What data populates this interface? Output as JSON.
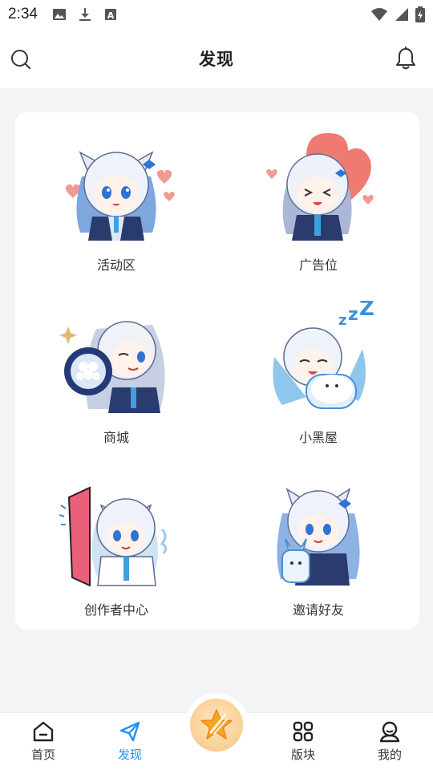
{
  "status_bar": {
    "time": "2:34",
    "left_icons": [
      "image-icon",
      "download-icon",
      "text-a-icon"
    ],
    "right_icons": [
      "wifi-icon",
      "signal-icon",
      "battery-icon"
    ]
  },
  "header": {
    "title": "发现",
    "left_icon": "search-icon",
    "right_icon": "bell-icon"
  },
  "grid": {
    "items": [
      {
        "label": "活动区",
        "icon": "mascot-hearts-illustration"
      },
      {
        "label": "广告位",
        "icon": "mascot-balloon-illustration"
      },
      {
        "label": "商城",
        "icon": "mascot-bouquet-illustration"
      },
      {
        "label": "小黑屋",
        "icon": "mascot-sleeping-illustration"
      },
      {
        "label": "创作者中心",
        "icon": "mascot-door-illustration"
      },
      {
        "label": "邀请好友",
        "icon": "mascot-plush-illustration"
      }
    ]
  },
  "bottom_nav": {
    "items": [
      {
        "label": "首页",
        "icon": "home-icon",
        "active": false
      },
      {
        "label": "发现",
        "icon": "paper-plane-icon",
        "active": true
      },
      {
        "label": "版块",
        "icon": "grid-icon",
        "active": false
      },
      {
        "label": "我的",
        "icon": "user-icon",
        "active": false
      }
    ],
    "center_icon": "star-pen-icon"
  },
  "colors": {
    "accent": "#1e90ff",
    "background": "#f4f4f6",
    "card": "#ffffff",
    "center_button": "#fbd29a",
    "star": "#f5a623"
  }
}
